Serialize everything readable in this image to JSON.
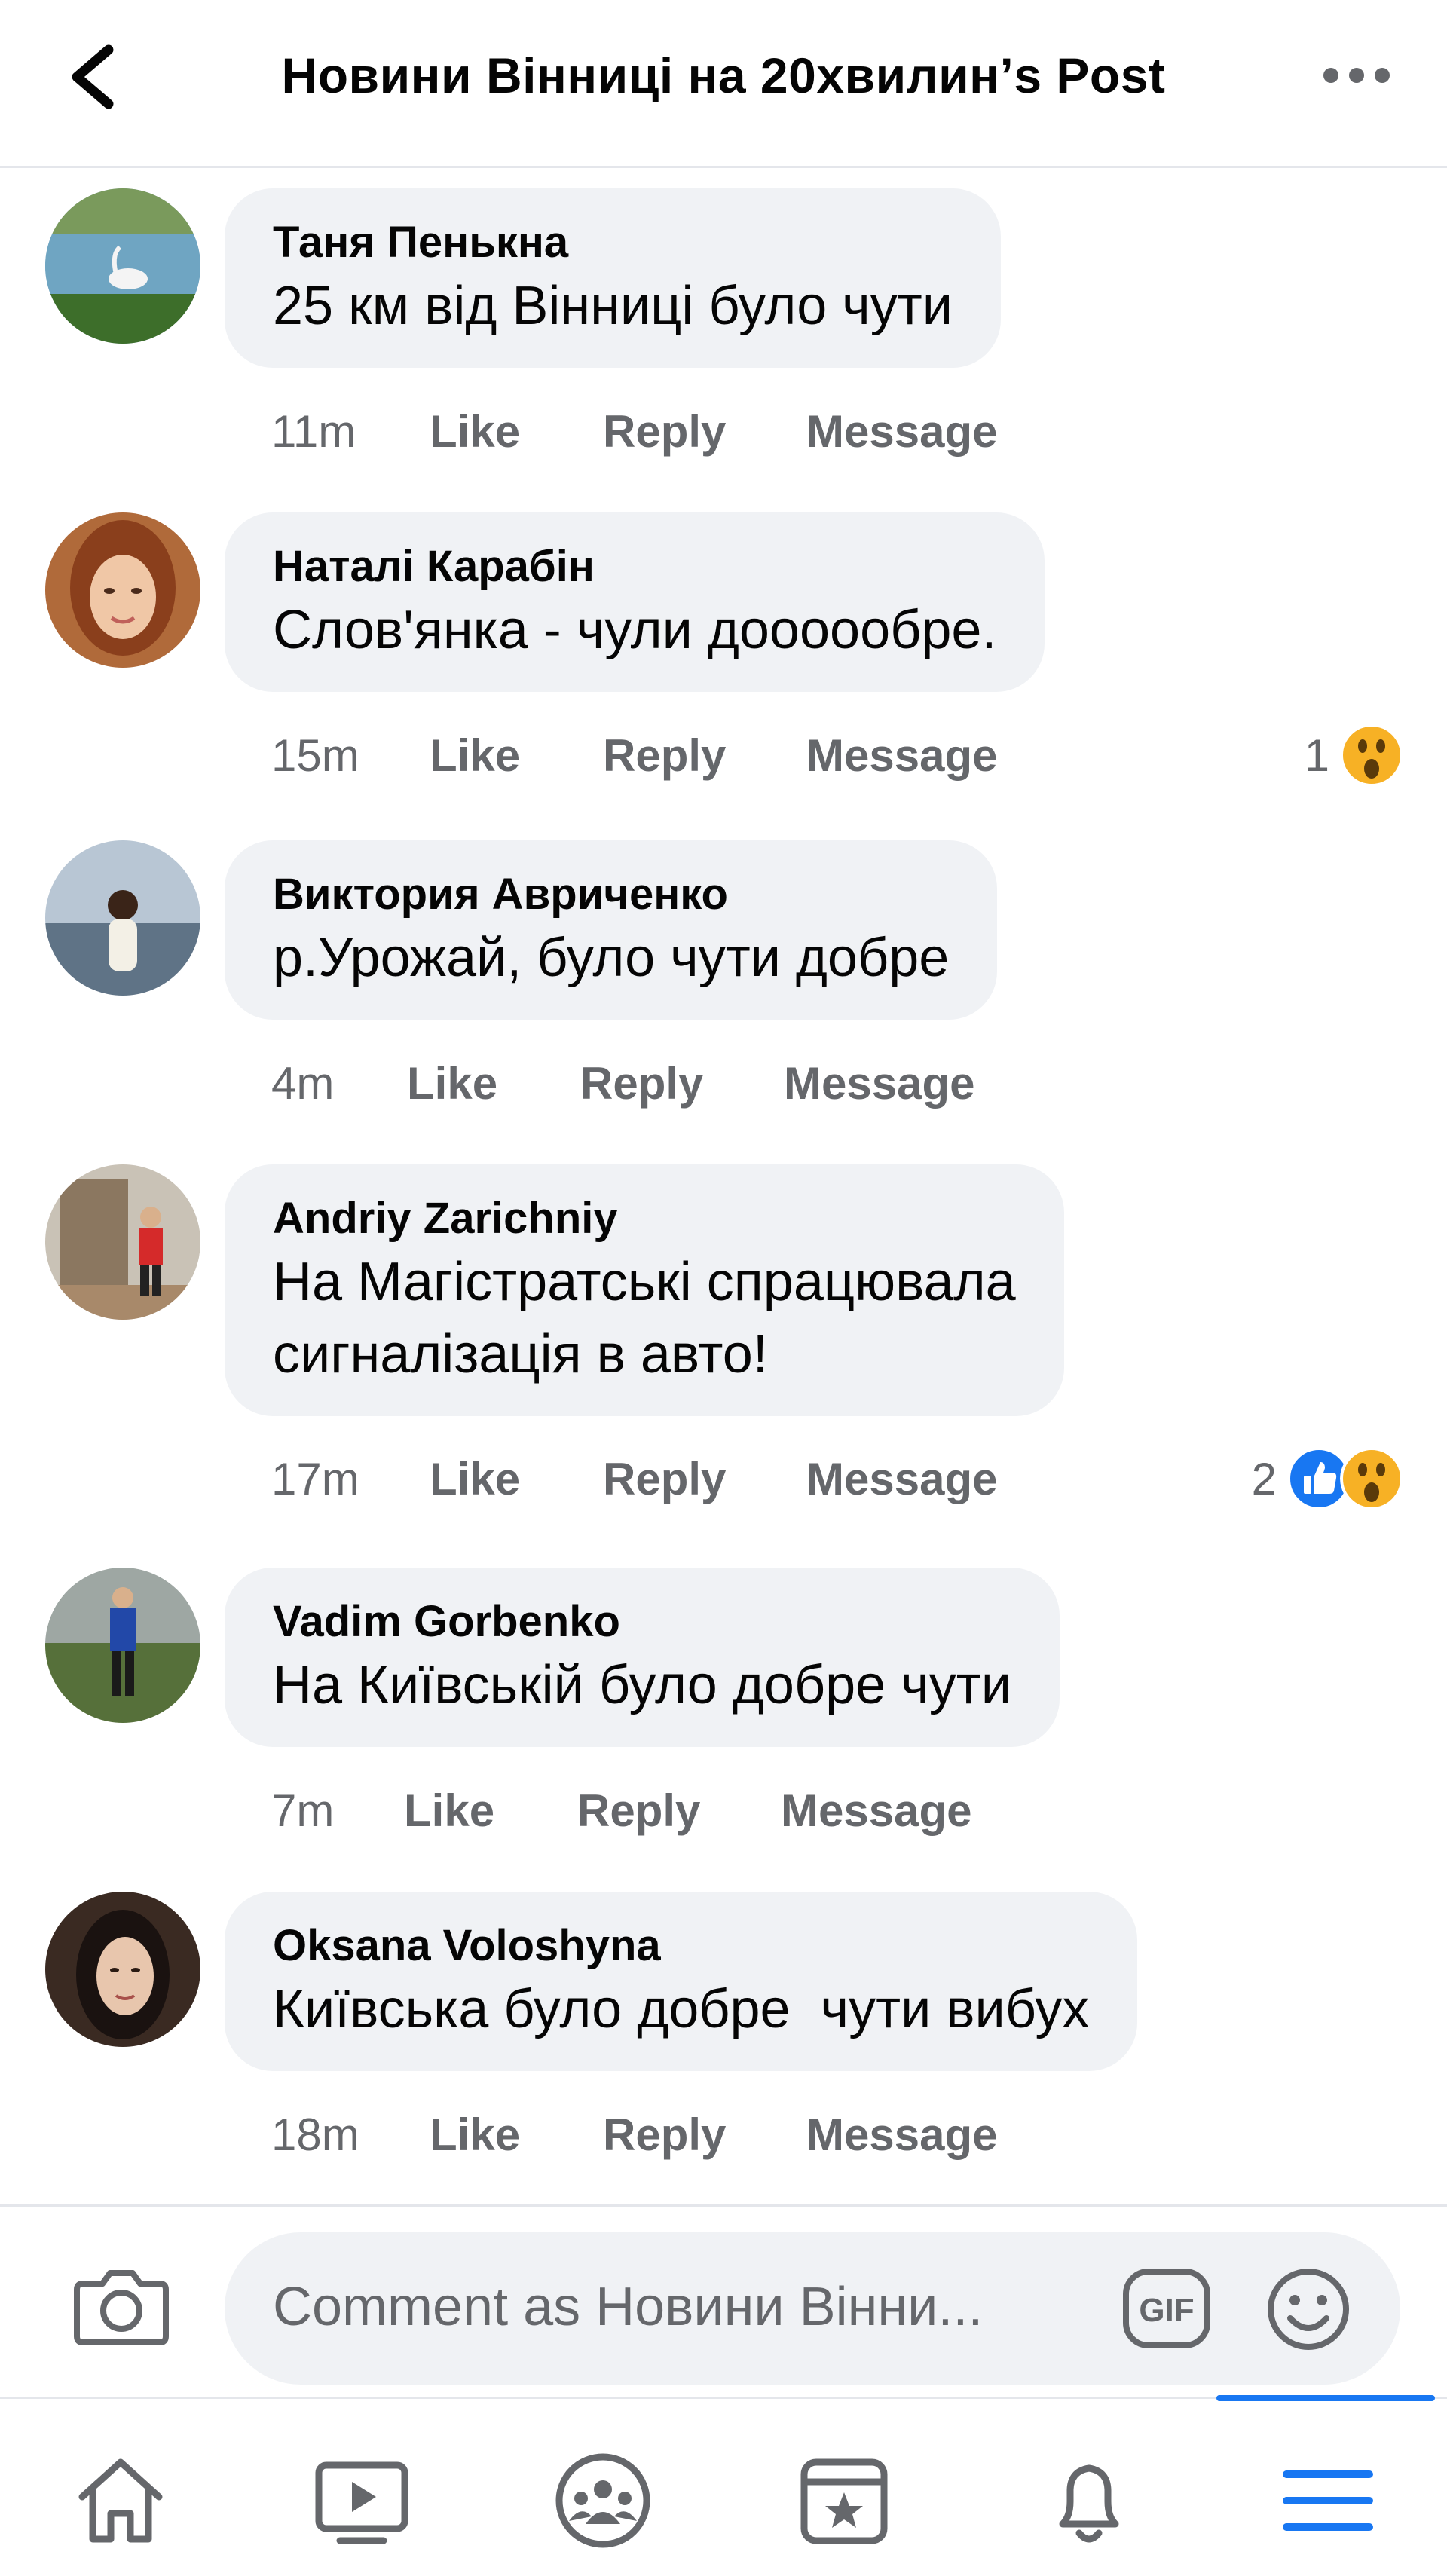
{
  "header": {
    "title": "Новини Вінниці  на 20хвилин’s Post",
    "back_icon": "chevron-left-icon",
    "more_icon": "more-horizontal-icon"
  },
  "actions": {
    "like": "Like",
    "reply": "Reply",
    "message": "Message"
  },
  "comments": [
    {
      "author": "Таня Пенькна",
      "text": "25 км від Вінниці було чути",
      "time": "11m",
      "reaction_count": "",
      "reactions": []
    },
    {
      "author": "Наталі Карабін",
      "text": "Слов'янка - чули доооообре.",
      "time": "15m",
      "reaction_count": "1",
      "reactions": [
        "wow"
      ]
    },
    {
      "author": "Виктория Авриченко",
      "text": "р.Урожай, було чути добре",
      "time": "4m",
      "reaction_count": "",
      "reactions": []
    },
    {
      "author": "Andriy  Zarichniy",
      "text": "На Магістратські спрацювала\nсигналізація в авто!",
      "time": "17m",
      "reaction_count": "2",
      "reactions": [
        "like",
        "wow"
      ]
    },
    {
      "author": "Vadim Gorbenko",
      "text": "На Київській було добре чути",
      "time": "7m",
      "reaction_count": "",
      "reactions": []
    },
    {
      "author": "Oksana Voloshyna",
      "text": "Київська було добре  чути вибух",
      "time": "18m",
      "reaction_count": "",
      "reactions": []
    }
  ],
  "comment_input": {
    "placeholder": "Comment as Новини Вінни...",
    "gif_label": "GIF"
  },
  "bottom_nav": {
    "items": [
      "home-icon",
      "video-icon",
      "groups-icon",
      "pages-icon",
      "notifications-icon",
      "menu-icon"
    ],
    "active": "menu-icon"
  },
  "colors": {
    "bubble": "#f0f2f5",
    "meta_text": "#65676b",
    "accent": "#1877f2",
    "wow_yellow": "#f7b125"
  }
}
